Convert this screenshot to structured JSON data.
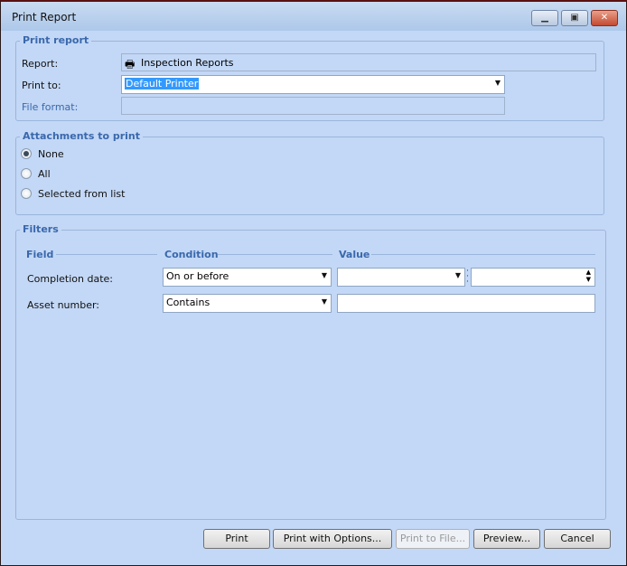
{
  "window": {
    "title": "Print Report",
    "controls": {
      "minimize": "minimize-icon",
      "maximize": "restore-icon",
      "close": "close-icon"
    }
  },
  "print_report": {
    "title": "Print report",
    "report_label": "Report:",
    "report_value": "Inspection Reports",
    "report_icon": "printer-icon",
    "print_to_label": "Print to:",
    "print_to_value": "Default Printer",
    "file_format_label": "File format:",
    "file_format_value": ""
  },
  "attachments": {
    "title": "Attachments to print",
    "options": [
      {
        "label": "None",
        "selected": true
      },
      {
        "label": "All",
        "selected": false
      },
      {
        "label": "Selected from list",
        "selected": false
      }
    ]
  },
  "filters": {
    "title": "Filters",
    "columns": [
      "Field",
      "Condition",
      "Value"
    ],
    "rows": [
      {
        "field": "Completion date:",
        "condition": "On or before",
        "value": "",
        "value2": ""
      },
      {
        "field": "Asset number:",
        "condition": "Contains",
        "value": ""
      }
    ]
  },
  "buttons": [
    {
      "label": "Print",
      "enabled": true
    },
    {
      "label": "Print with Options...",
      "enabled": true
    },
    {
      "label": "Print to File...",
      "enabled": false
    },
    {
      "label": "Preview...",
      "enabled": true
    },
    {
      "label": "Cancel",
      "enabled": true
    }
  ]
}
